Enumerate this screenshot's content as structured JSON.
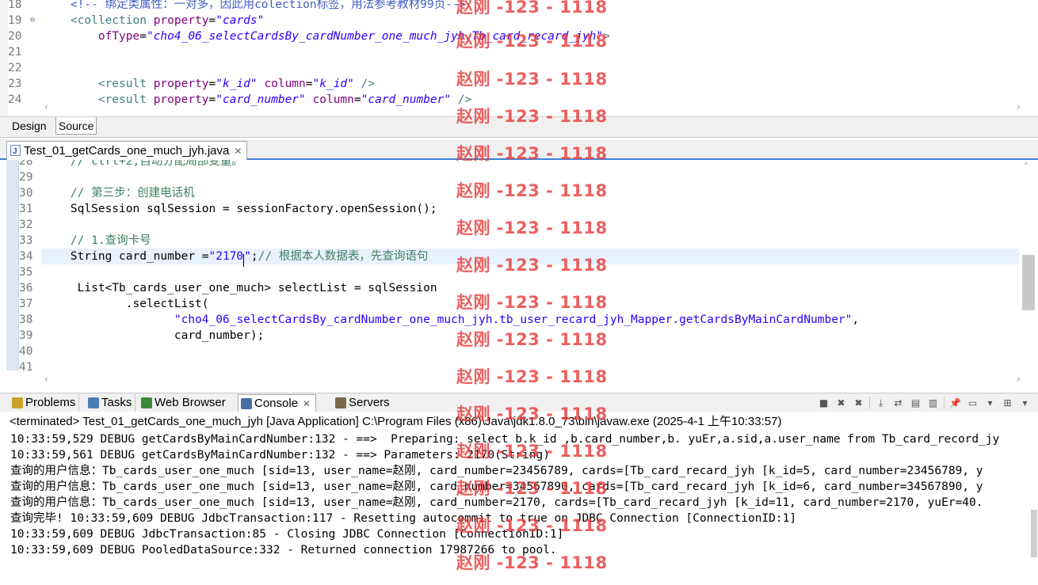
{
  "xml_editor": {
    "lines": [
      {
        "num": "18",
        "fold": "",
        "parts": [
          {
            "t": "    ",
            "c": ""
          },
          {
            "t": "<!-- 绑定类属性：一对多，因此用colection标签，用法参考教材99页-->",
            "c": "x-com"
          }
        ]
      },
      {
        "num": "19",
        "fold": "⊖",
        "parts": [
          {
            "t": "    ",
            "c": ""
          },
          {
            "t": "<collection ",
            "c": "x-tag"
          },
          {
            "t": "property",
            "c": "x-attr"
          },
          {
            "t": "=",
            "c": ""
          },
          {
            "t": "\"cards\"",
            "c": "x-val"
          }
        ]
      },
      {
        "num": "20",
        "fold": "",
        "parts": [
          {
            "t": "        ",
            "c": ""
          },
          {
            "t": "ofType",
            "c": "x-attr"
          },
          {
            "t": "=",
            "c": ""
          },
          {
            "t": "\"cho4_06_selectCardsBy_cardNumber_one_much_jyh.Tb_card_recard_jyh\"",
            "c": "x-val"
          },
          {
            "t": ">",
            "c": "x-tag"
          }
        ]
      },
      {
        "num": "21",
        "fold": "",
        "parts": []
      },
      {
        "num": "22",
        "fold": "",
        "parts": []
      },
      {
        "num": "23",
        "fold": "",
        "parts": [
          {
            "t": "        ",
            "c": ""
          },
          {
            "t": "<result ",
            "c": "x-tag"
          },
          {
            "t": "property",
            "c": "x-attr"
          },
          {
            "t": "=",
            "c": ""
          },
          {
            "t": "\"k_id\"",
            "c": "x-val"
          },
          {
            "t": " ",
            "c": ""
          },
          {
            "t": "column",
            "c": "x-attr"
          },
          {
            "t": "=",
            "c": ""
          },
          {
            "t": "\"k_id\"",
            "c": "x-val"
          },
          {
            "t": " />",
            "c": "x-tag"
          }
        ]
      },
      {
        "num": "24",
        "fold": "",
        "parts": [
          {
            "t": "        ",
            "c": ""
          },
          {
            "t": "<result ",
            "c": "x-tag"
          },
          {
            "t": "property",
            "c": "x-attr"
          },
          {
            "t": "=",
            "c": ""
          },
          {
            "t": "\"card_number\"",
            "c": "x-val"
          },
          {
            "t": " ",
            "c": ""
          },
          {
            "t": "column",
            "c": "x-attr"
          },
          {
            "t": "=",
            "c": ""
          },
          {
            "t": "\"card_number\"",
            "c": "x-val"
          },
          {
            "t": " />",
            "c": "x-tag"
          }
        ]
      }
    ]
  },
  "editor_tabs": {
    "design": "Design",
    "source": "Source"
  },
  "java_editor": {
    "tab_title": "Test_01_getCards_one_much_jyh.java",
    "tab_close": "✕",
    "current_line": "34",
    "lines": [
      {
        "num": "28",
        "parts": [
          {
            "t": "    ",
            "c": ""
          },
          {
            "t": "// ctrl+2,自动分配局部变量。",
            "c": "j-com"
          }
        ]
      },
      {
        "num": "29",
        "parts": []
      },
      {
        "num": "30",
        "parts": [
          {
            "t": "    ",
            "c": ""
          },
          {
            "t": "// 第三步：创建电话机",
            "c": "j-com"
          }
        ]
      },
      {
        "num": "31",
        "parts": [
          {
            "t": "    SqlSession sqlSession = sessionFactory.openSession();",
            "c": ""
          }
        ]
      },
      {
        "num": "32",
        "parts": []
      },
      {
        "num": "33",
        "parts": [
          {
            "t": "    ",
            "c": ""
          },
          {
            "t": "// 1.查询卡号",
            "c": "j-com"
          }
        ]
      },
      {
        "num": "34",
        "parts": [
          {
            "t": "    String card_number =",
            "c": ""
          },
          {
            "t": "\"2170",
            "c": "j-str"
          },
          {
            "t": "|",
            "c": "caret"
          },
          {
            "t": "\"",
            "c": "j-str"
          },
          {
            "t": ";",
            "c": ""
          },
          {
            "t": "// 根据本人数据表，先查询语句",
            "c": "j-com"
          }
        ]
      },
      {
        "num": "35",
        "parts": []
      },
      {
        "num": "36",
        "parts": [
          {
            "t": "     List<Tb_cards_user_one_much> selectList = sqlSession",
            "c": ""
          }
        ]
      },
      {
        "num": "37",
        "parts": [
          {
            "t": "            .selectList(",
            "c": ""
          }
        ]
      },
      {
        "num": "38",
        "parts": [
          {
            "t": "                   ",
            "c": ""
          },
          {
            "t": "\"cho4_06_selectCardsBy_cardNumber_one_much_jyh.tb_user_recard_jyh_Mapper.getCardsByMainCardNumber\"",
            "c": "j-str"
          },
          {
            "t": ",",
            "c": ""
          }
        ]
      },
      {
        "num": "39",
        "parts": [
          {
            "t": "                   card_number);",
            "c": ""
          }
        ]
      },
      {
        "num": "40",
        "parts": []
      },
      {
        "num": "41",
        "parts": []
      }
    ]
  },
  "panel": {
    "tabs": [
      {
        "label": "Problems",
        "name": "tab-problems",
        "icon": "problems-icon",
        "color": "#c9a227"
      },
      {
        "label": "Tasks",
        "name": "tab-tasks",
        "icon": "tasks-icon",
        "color": "#4a7bb7"
      },
      {
        "label": "Web Browser",
        "name": "tab-web-browser",
        "icon": "globe-icon",
        "color": "#3a8a3a"
      },
      {
        "label": "Console",
        "name": "tab-console",
        "icon": "console-icon",
        "color": "#4a6da7"
      },
      {
        "label": "Servers",
        "name": "tab-servers",
        "icon": "servers-icon",
        "color": "#7a6a4a"
      }
    ],
    "console_close": "✕",
    "toolbar_icons": [
      "terminate-icon",
      "remove-launch-icon",
      "remove-all-icon",
      "scroll-lock-icon",
      "word-wrap-icon",
      "show-stdout-icon",
      "show-stderr-icon",
      "pin-console-icon",
      "display-console-icon",
      "display-dropdown-icon",
      "open-console-icon",
      "open-dropdown-icon"
    ],
    "toolbar_glyphs": [
      "■",
      "✖",
      "✖",
      "⤓",
      "⇄",
      "▤",
      "▥",
      "📌",
      "▭",
      "▾",
      "⊞",
      "▾"
    ]
  },
  "console": {
    "header": "<terminated> Test_01_getCards_one_much_jyh [Java Application] C:\\Program Files (x86)\\Java\\jdk1.8.0_73\\bin\\javaw.exe (2025-4-1 上午10:33:57)",
    "lines": [
      "10:33:59,529 DEBUG getCardsByMainCardNumber:132 - ==>  Preparing: select b.k_id ,b.card_number,b. yuEr,a.sid,a.user_name from Tb_card_record_jy",
      "10:33:59,561 DEBUG getCardsByMainCardNumber:132 - ==> Parameters: 2170(String)",
      "查询的用户信息：Tb_cards_user_one_much [sid=13, user_name=赵刚, card_number=23456789, cards=[Tb_card_recard_jyh [k_id=5, card_number=23456789, y",
      "查询的用户信息：Tb_cards_user_one_much [sid=13, user_name=赵刚, card_number=34567890, cards=[Tb_card_recard_jyh [k_id=6, card_number=34567890, y",
      "查询的用户信息：Tb_cards_user_one_much [sid=13, user_name=赵刚, card_number=2170, cards=[Tb_card_recard_jyh [k_id=11, card_number=2170, yuEr=40.",
      "查询完毕! 10:33:59,609 DEBUG JdbcTransaction:117 - Resetting autocommit to true on JDBC Connection [ConnectionID:1]",
      "10:33:59,609 DEBUG JdbcTransaction:85 - Closing JDBC Connection [ConnectionID:1]",
      "10:33:59,609 DEBUG PooledDataSource:332 - Returned connection 17987266 to pool."
    ]
  },
  "watermark": {
    "text": "赵刚 -123 - 1118",
    "color": "#e83c3c"
  }
}
